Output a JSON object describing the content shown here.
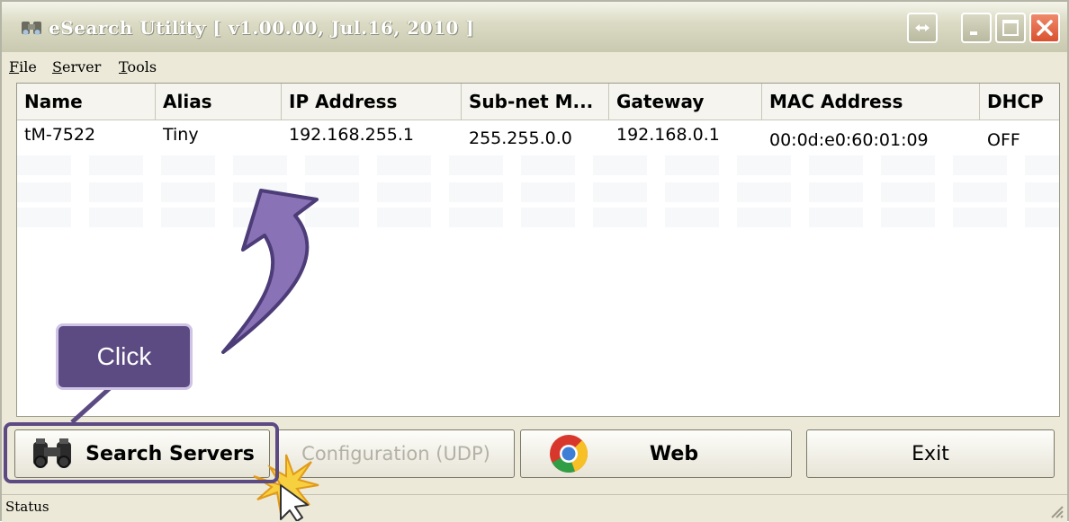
{
  "window": {
    "title": "eSearch Utility [ v1.00.00, Jul.16, 2010 ]"
  },
  "menu": [
    {
      "label": "File",
      "u": "F",
      "rest": "ile"
    },
    {
      "label": "Server",
      "u": "S",
      "rest": "erver"
    },
    {
      "label": "Tools",
      "u": "T",
      "rest": "ools"
    }
  ],
  "table": {
    "columns": [
      "Name",
      "Alias",
      "IP Address",
      "Sub-net M...",
      "Gateway",
      "MAC Address",
      "DHCP"
    ],
    "rows": [
      [
        "tM-7522",
        "Tiny",
        "192.168.255.1",
        "255.255.0.0",
        "192.168.0.1",
        "00:0d:e0:60:01:09",
        "OFF"
      ]
    ]
  },
  "buttons": {
    "search": "Search Servers",
    "config": "Configuration (UDP)",
    "web": "Web",
    "exit": "Exit"
  },
  "status": "Status",
  "annotation": {
    "callout": "Click",
    "color": "#5c4a82"
  },
  "icons": [
    "app-icon",
    "binoculars-icon",
    "chrome-icon",
    "restore-arrows-icon",
    "minimize-icon",
    "maximize-icon",
    "close-icon",
    "size-grip-icon",
    "mouse-cursor-icon",
    "click-burst-icon",
    "curved-arrow"
  ]
}
